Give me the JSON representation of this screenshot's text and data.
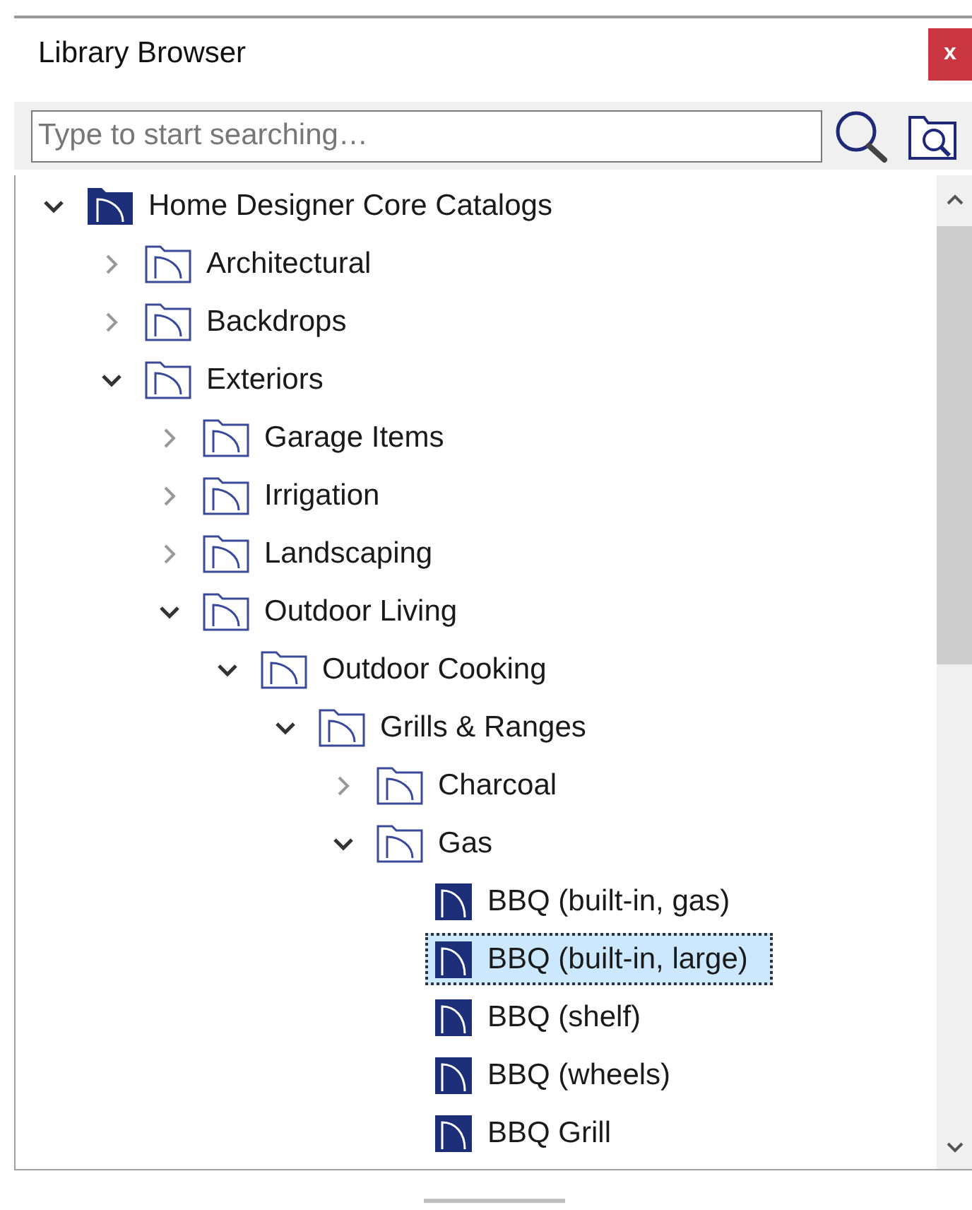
{
  "panel": {
    "title": "Library Browser",
    "close_label": "x"
  },
  "search": {
    "placeholder": "Type to start searching…"
  },
  "tree": [
    {
      "label": "Home Designer Core Catalogs",
      "kind": "catalog",
      "expanded": true,
      "selected": false,
      "children": [
        {
          "label": "Architectural",
          "kind": "folder",
          "expanded": false,
          "selected": false
        },
        {
          "label": "Backdrops",
          "kind": "folder",
          "expanded": false,
          "selected": false
        },
        {
          "label": "Exteriors",
          "kind": "folder",
          "expanded": true,
          "selected": false,
          "children": [
            {
              "label": "Garage Items",
              "kind": "folder",
              "expanded": false,
              "selected": false
            },
            {
              "label": "Irrigation",
              "kind": "folder",
              "expanded": false,
              "selected": false
            },
            {
              "label": "Landscaping",
              "kind": "folder",
              "expanded": false,
              "selected": false
            },
            {
              "label": "Outdoor Living",
              "kind": "folder",
              "expanded": true,
              "selected": false,
              "children": [
                {
                  "label": "Outdoor Cooking",
                  "kind": "folder",
                  "expanded": true,
                  "selected": false,
                  "children": [
                    {
                      "label": "Grills & Ranges",
                      "kind": "folder",
                      "expanded": true,
                      "selected": false,
                      "children": [
                        {
                          "label": "Charcoal",
                          "kind": "folder",
                          "expanded": false,
                          "selected": false
                        },
                        {
                          "label": "Gas",
                          "kind": "folder",
                          "expanded": true,
                          "selected": false,
                          "children": [
                            {
                              "label": "BBQ (built-in, gas)",
                              "kind": "item",
                              "selected": false
                            },
                            {
                              "label": "BBQ (built-in, large)",
                              "kind": "item",
                              "selected": true
                            },
                            {
                              "label": "BBQ (shelf)",
                              "kind": "item",
                              "selected": false
                            },
                            {
                              "label": "BBQ (wheels)",
                              "kind": "item",
                              "selected": false
                            },
                            {
                              "label": "BBQ Grill",
                              "kind": "item",
                              "selected": false
                            }
                          ]
                        }
                      ]
                    }
                  ]
                }
              ]
            }
          ]
        }
      ]
    }
  ]
}
